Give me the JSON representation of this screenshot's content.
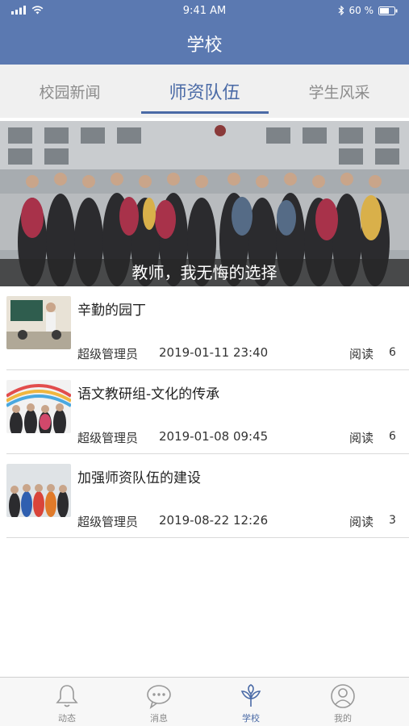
{
  "status_bar": {
    "time": "9:41 AM",
    "battery": "60 %"
  },
  "header": {
    "title": "学校"
  },
  "tabs": [
    {
      "label": "校园新闻",
      "active": false
    },
    {
      "label": "师资队伍",
      "active": true
    },
    {
      "label": "学生风采",
      "active": false
    }
  ],
  "banner": {
    "caption": "教师，我无悔的选择"
  },
  "news": [
    {
      "title": "辛勤的园丁",
      "author": "超级管理员",
      "date": "2019-01-11 23:40",
      "read_label": "阅读",
      "read_count": "6"
    },
    {
      "title": "语文教研组-文化的传承",
      "author": "超级管理员",
      "date": "2019-01-08 09:45",
      "read_label": "阅读",
      "read_count": "6"
    },
    {
      "title": "加强师资队伍的建设",
      "author": "超级管理员",
      "date": "2019-08-22 12:26",
      "read_label": "阅读",
      "read_count": "3"
    }
  ],
  "tabbar": [
    {
      "label": "动态",
      "icon": "bell-icon"
    },
    {
      "label": "消息",
      "icon": "chat-icon"
    },
    {
      "label": "学校",
      "icon": "sprout-icon",
      "active": true
    },
    {
      "label": "我的",
      "icon": "user-icon"
    }
  ],
  "colors": {
    "header": "#5b79b1",
    "accent": "#4a6aa6",
    "inactive": "#8c8c8c"
  }
}
